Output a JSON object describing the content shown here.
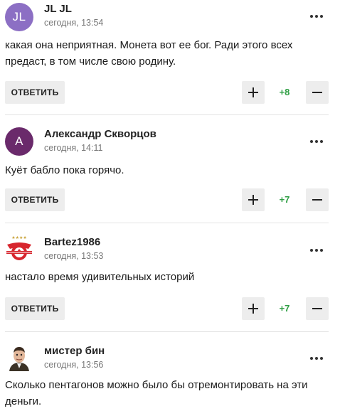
{
  "comments": [
    {
      "author": "JL JL",
      "time": "сегодня, 13:54",
      "avatar_initials": "JL",
      "avatar_color": "#8c6fc4",
      "text": "какая она неприятная. Монета вот ее бог. Ради этого всех предаст, в том числе свою родину.",
      "reply_label": "ОТВЕТИТЬ",
      "score": "+8"
    },
    {
      "author": "Александр Скворцов",
      "time": "сегодня, 14:11",
      "avatar_initials": "А",
      "avatar_color": "#6a2a6b",
      "text": "Куёт бабло пока горячо.",
      "reply_label": "ОТВЕТИТЬ",
      "score": "+7"
    },
    {
      "author": "Bartez1986",
      "time": "сегодня, 13:53",
      "avatar_icon": "spartak-club-logo-icon",
      "avatar_color": "#d7262e",
      "text": "настало время удивительных историй",
      "reply_label": "ОТВЕТИТЬ",
      "score": "+7"
    },
    {
      "author": "мистер бин",
      "time": "сегодня, 13:56",
      "avatar_icon": "user-photo-icon",
      "text": "Сколько пентагонов можно было бы отремонтировать на эти деньги."
    }
  ],
  "colors": {
    "score_positive": "#2e9e43",
    "button_bg": "#ededed"
  }
}
